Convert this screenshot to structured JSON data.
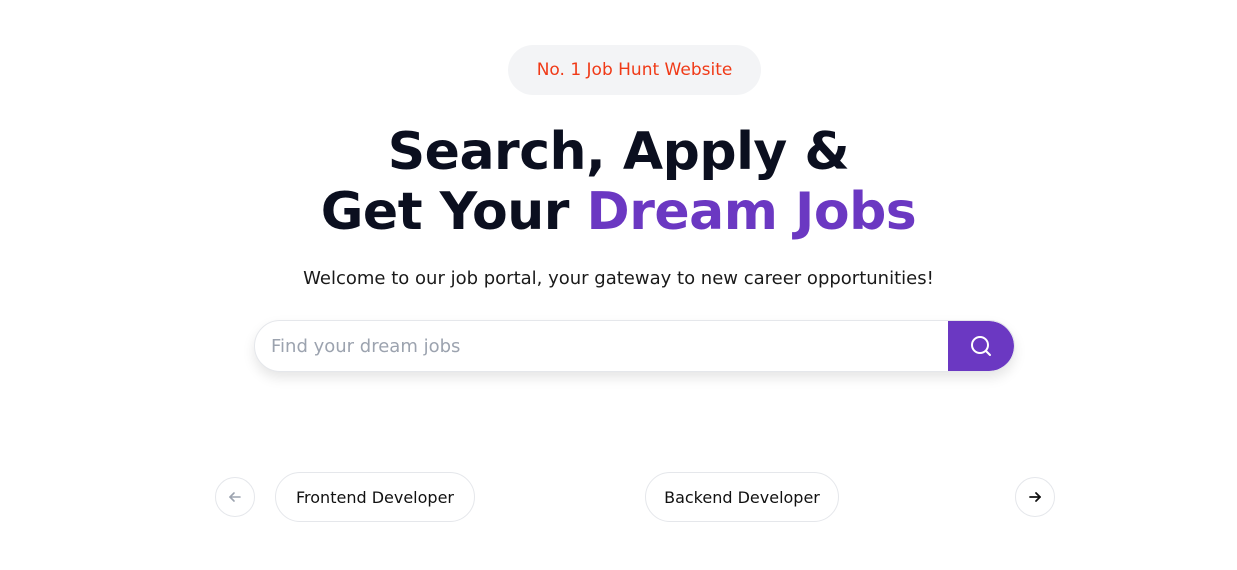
{
  "hero": {
    "badge": "No. 1 Job Hunt Website",
    "headline_line1": "Search, Apply &",
    "headline_line2_prefix": "Get Your ",
    "headline_line2_accent": "Dream Jobs",
    "subtitle": "Welcome to our job portal, your gateway to new career opportunities!"
  },
  "search": {
    "placeholder": "Find your dream jobs",
    "value": "",
    "button_icon": "search-icon"
  },
  "carousel": {
    "prev_icon": "arrow-left-icon",
    "next_icon": "arrow-right-icon",
    "items": [
      {
        "label": "Frontend Developer"
      },
      {
        "label": "Backend Developer"
      }
    ]
  },
  "colors": {
    "accent": "#6b38c2",
    "badge_text": "#f03a17",
    "badge_bg": "#f3f4f6",
    "headline": "#0b0f1f"
  }
}
